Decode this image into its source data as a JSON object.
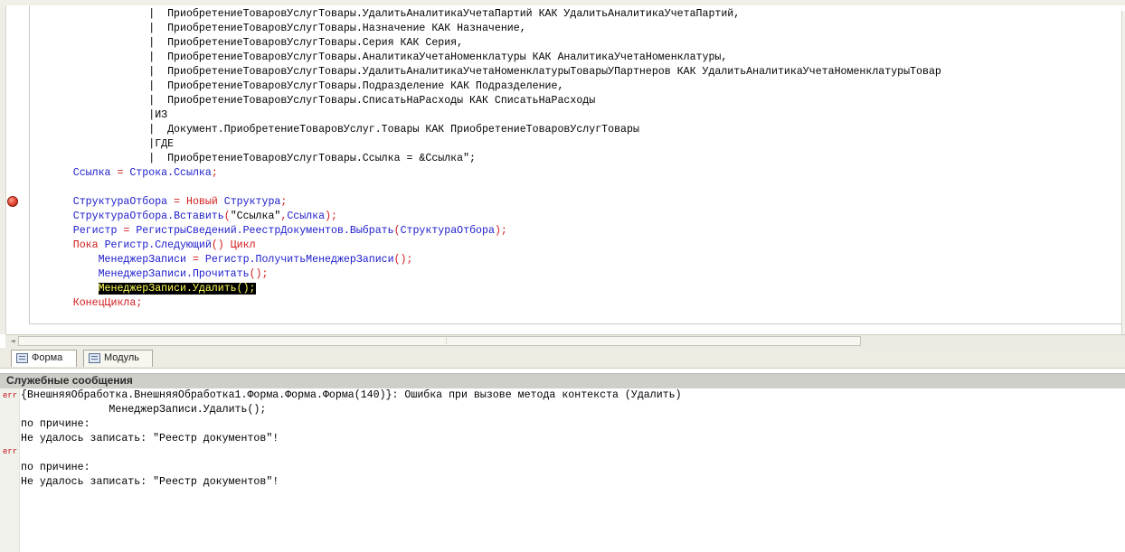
{
  "code_lines": [
    {
      "parts": [
        {
          "t": "                  |  ПриобретениеТоваровУслугТовары.УдалитьАналитикаУчетаПартий КАК УдалитьАналитикаУчетаПартий,",
          "c": "txt"
        }
      ]
    },
    {
      "parts": [
        {
          "t": "                  |  ПриобретениеТоваровУслугТовары.Назначение КАК Назначение,",
          "c": "txt"
        }
      ]
    },
    {
      "parts": [
        {
          "t": "                  |  ПриобретениеТоваровУслугТовары.Серия КАК Серия,",
          "c": "txt"
        }
      ]
    },
    {
      "parts": [
        {
          "t": "                  |  ПриобретениеТоваровУслугТовары.АналитикаУчетаНоменклатуры КАК АналитикаУчетаНоменклатуры,",
          "c": "txt"
        }
      ]
    },
    {
      "parts": [
        {
          "t": "                  |  ПриобретениеТоваровУслугТовары.УдалитьАналитикаУчетаНоменклатурыТоварыУПартнеров КАК УдалитьАналитикаУчетаНоменклатурыТовар",
          "c": "txt"
        }
      ]
    },
    {
      "parts": [
        {
          "t": "                  |  ПриобретениеТоваровУслугТовары.Подразделение КАК Подразделение,",
          "c": "txt"
        }
      ]
    },
    {
      "parts": [
        {
          "t": "                  |  ПриобретениеТоваровУслугТовары.СписатьНаРасходы КАК СписатьНаРасходы",
          "c": "txt"
        }
      ]
    },
    {
      "parts": [
        {
          "t": "                  |ИЗ",
          "c": "txt"
        }
      ]
    },
    {
      "parts": [
        {
          "t": "                  |  Документ.ПриобретениеТоваровУслуг.Товары КАК ПриобретениеТоваровУслугТовары",
          "c": "txt"
        }
      ]
    },
    {
      "parts": [
        {
          "t": "                  |ГДЕ",
          "c": "txt"
        }
      ]
    },
    {
      "parts": [
        {
          "t": "                  |  ПриобретениеТоваровУслугТовары.Ссылка = &Ссылка\";",
          "c": "txt"
        }
      ]
    },
    {
      "parts": [
        {
          "t": "      ",
          "c": "txt"
        },
        {
          "t": "Ссылка",
          "c": "id"
        },
        {
          "t": " = ",
          "c": "op"
        },
        {
          "t": "Строка.Ссылка",
          "c": "id"
        },
        {
          "t": ";",
          "c": "op"
        }
      ]
    },
    {
      "parts": []
    },
    {
      "parts": [
        {
          "t": "      ",
          "c": "txt"
        },
        {
          "t": "СтруктураОтбора",
          "c": "id"
        },
        {
          "t": " = ",
          "c": "op"
        },
        {
          "t": "Новый",
          "c": "kw"
        },
        {
          "t": " ",
          "c": "txt"
        },
        {
          "t": "Структура",
          "c": "id"
        },
        {
          "t": ";",
          "c": "op"
        }
      ]
    },
    {
      "parts": [
        {
          "t": "      ",
          "c": "txt"
        },
        {
          "t": "СтруктураОтбора.Вставить",
          "c": "id"
        },
        {
          "t": "(",
          "c": "op"
        },
        {
          "t": "\"Ссылка\"",
          "c": "str"
        },
        {
          "t": ",",
          "c": "op"
        },
        {
          "t": "Ссылка",
          "c": "id"
        },
        {
          "t": ");",
          "c": "op"
        }
      ]
    },
    {
      "parts": [
        {
          "t": "      ",
          "c": "txt"
        },
        {
          "t": "Регистр",
          "c": "id"
        },
        {
          "t": " = ",
          "c": "op"
        },
        {
          "t": "РегистрыСведений.РеестрДокументов.Выбрать",
          "c": "id"
        },
        {
          "t": "(",
          "c": "op"
        },
        {
          "t": "СтруктураОтбора",
          "c": "id"
        },
        {
          "t": ");",
          "c": "op"
        }
      ]
    },
    {
      "parts": [
        {
          "t": "      ",
          "c": "txt"
        },
        {
          "t": "Пока",
          "c": "kw"
        },
        {
          "t": " ",
          "c": "txt"
        },
        {
          "t": "Регистр.Следующий",
          "c": "id"
        },
        {
          "t": "() ",
          "c": "op"
        },
        {
          "t": "Цикл",
          "c": "kw"
        }
      ]
    },
    {
      "parts": [
        {
          "t": "          ",
          "c": "txt"
        },
        {
          "t": "МенеджерЗаписи",
          "c": "id"
        },
        {
          "t": " = ",
          "c": "op"
        },
        {
          "t": "Регистр.ПолучитьМенеджерЗаписи",
          "c": "id"
        },
        {
          "t": "();",
          "c": "op"
        }
      ]
    },
    {
      "parts": [
        {
          "t": "          ",
          "c": "txt"
        },
        {
          "t": "МенеджерЗаписи.Прочитать",
          "c": "id"
        },
        {
          "t": "();",
          "c": "op"
        }
      ]
    },
    {
      "parts": [
        {
          "t": "          ",
          "c": "txt"
        },
        {
          "t": "МенеджерЗаписи.Удалить();",
          "c": "hl"
        }
      ]
    },
    {
      "parts": [
        {
          "t": "      ",
          "c": "txt"
        },
        {
          "t": "КонецЦикла",
          "c": "kw"
        },
        {
          "t": ";",
          "c": "op"
        }
      ]
    }
  ],
  "tabs": [
    {
      "label": "Форма"
    },
    {
      "label": "Модуль"
    }
  ],
  "messages": {
    "header": "Служебные сообщения",
    "err_tag": "err",
    "lines": [
      "{ВнешняяОбработка.ВнешняяОбработка1.Форма.Форма.Форма(140)}: Ошибка при вызове метода контекста (Удалить)",
      "              МенеджерЗаписи.Удалить();",
      "по причине:",
      "Не удалось записать: \"Реестр документов\"!",
      "",
      "по причине:",
      "Не удалось записать: \"Реестр документов\"!"
    ]
  },
  "colors": {
    "keyword": "#d31a1a",
    "identifier": "#1b1bcc",
    "highlight_bg": "#000000",
    "highlight_fg": "#ffff55",
    "message_header_bg": "#cfcfca"
  },
  "icons": {
    "breakpoint": "breakpoint-icon",
    "form_tab": "form-icon",
    "module_tab": "module-icon"
  }
}
